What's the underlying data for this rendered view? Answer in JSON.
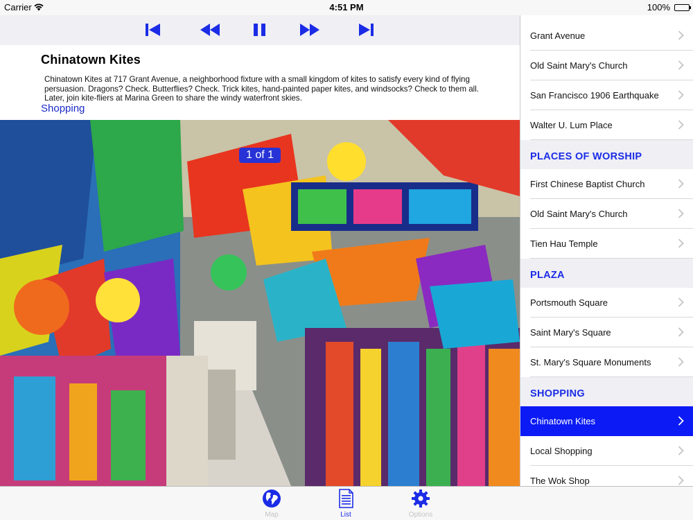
{
  "status_bar": {
    "carrier": "Carrier",
    "time": "4:51 PM",
    "battery": "100%",
    "battery_level": 1.0
  },
  "toolbar": {
    "buttons": [
      {
        "name": "skip-to-start",
        "icon": "skip-back-icon"
      },
      {
        "name": "rewind",
        "icon": "rewind-icon"
      },
      {
        "name": "pause",
        "icon": "pause-icon"
      },
      {
        "name": "fast-forward",
        "icon": "fast-forward-icon"
      },
      {
        "name": "skip-to-end",
        "icon": "skip-forward-icon"
      }
    ],
    "accent": "#1b2ce6"
  },
  "detail": {
    "title": "Chinatown Kites",
    "description": "Chinatown Kites at 717 Grant Avenue, a neighborhood fixture with a small kingdom of kites to satisfy every kind of flying persuasion. Dragons? Check. Butterflies? Check. Trick kites, hand-painted paper kites, and windsocks? Check to them all. Later, join kite-fliers at Marina Green to share the windy waterfront skies.",
    "category": "Shopping",
    "photo_counter": "1 of 1"
  },
  "list": {
    "rows": [
      {
        "type": "item",
        "label": "Grant Avenue"
      },
      {
        "type": "item",
        "label": "Old Saint Mary's Church"
      },
      {
        "type": "item",
        "label": "San Francisco 1906 Earthquake"
      },
      {
        "type": "item",
        "label": "Walter U. Lum Place"
      },
      {
        "type": "header",
        "label": "PLACES OF WORSHIP"
      },
      {
        "type": "item",
        "label": "First Chinese Baptist Church"
      },
      {
        "type": "item",
        "label": "Old Saint Mary's Church"
      },
      {
        "type": "item",
        "label": "Tien Hau Temple"
      },
      {
        "type": "header",
        "label": "PLAZA"
      },
      {
        "type": "item",
        "label": "Portsmouth Square"
      },
      {
        "type": "item",
        "label": "Saint Mary's Square"
      },
      {
        "type": "item",
        "label": "St. Mary's Square Monuments"
      },
      {
        "type": "header",
        "label": "SHOPPING"
      },
      {
        "type": "item",
        "label": "Chinatown Kites",
        "selected": true
      },
      {
        "type": "item",
        "label": "Local Shopping"
      },
      {
        "type": "item",
        "label": "The Wok Shop"
      }
    ],
    "selected_color": "#0c1bf5",
    "header_color": "#1b2ce6"
  },
  "tabbar": {
    "tabs": [
      {
        "label": "Map",
        "icon": "globe-icon",
        "active": false
      },
      {
        "label": "List",
        "icon": "document-icon",
        "active": true
      },
      {
        "label": "Options",
        "icon": "gear-icon",
        "active": false
      }
    ]
  }
}
